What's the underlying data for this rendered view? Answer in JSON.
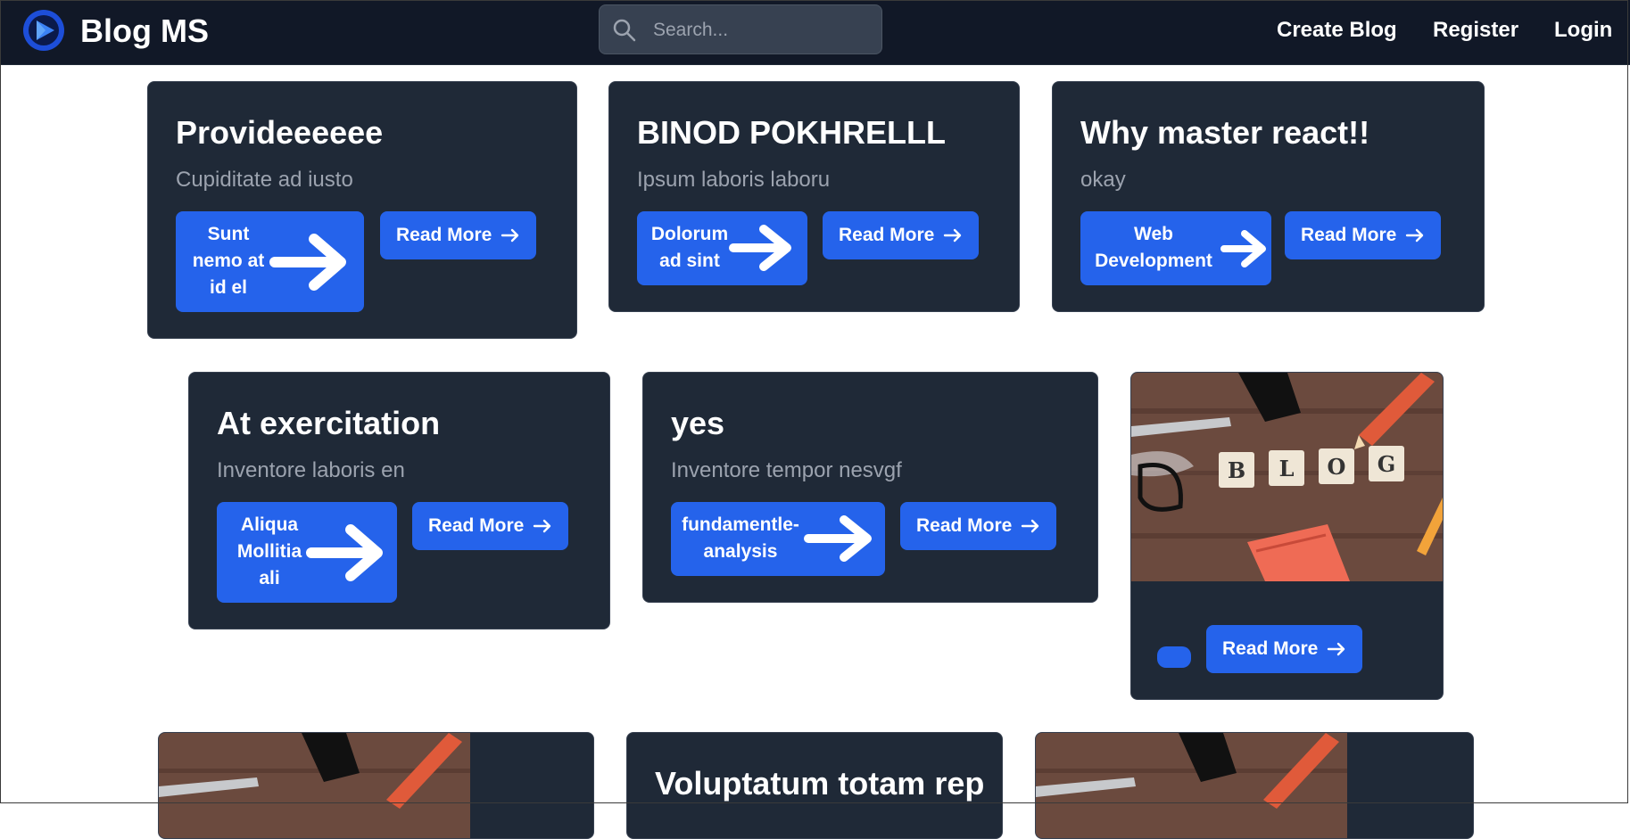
{
  "header": {
    "brand": "Blog MS",
    "search_placeholder": "Search...",
    "nav": [
      "Create Blog",
      "Register",
      "Login"
    ]
  },
  "read_more_label": "Read More",
  "blog_image_text": [
    "B",
    "L",
    "O",
    "G"
  ],
  "cards": [
    {
      "title": "Provideeeeee",
      "subtitle": "Cupiditate ad iusto",
      "tag": "Sunt nemo at id el"
    },
    {
      "title": "BINOD POKHRELLL",
      "subtitle": "Ipsum laboris laboru",
      "tag": "Dolorum ad sint"
    },
    {
      "title": "Why master react!!",
      "subtitle": "okay",
      "tag": "Web Development"
    },
    {
      "title": "At exercitation",
      "subtitle": "Inventore laboris en",
      "tag": "Aliqua Mollitia ali"
    },
    {
      "title": "yes",
      "subtitle": "Inventore tempor nesvgf",
      "tag": "fundamentle-analysis"
    },
    {
      "title": "Voluptatum totam rep"
    }
  ],
  "colors": {
    "nav_bg": "#111827",
    "card_bg": "#1f2937",
    "accent": "#2563eb",
    "subtitle": "#9ca3af"
  }
}
